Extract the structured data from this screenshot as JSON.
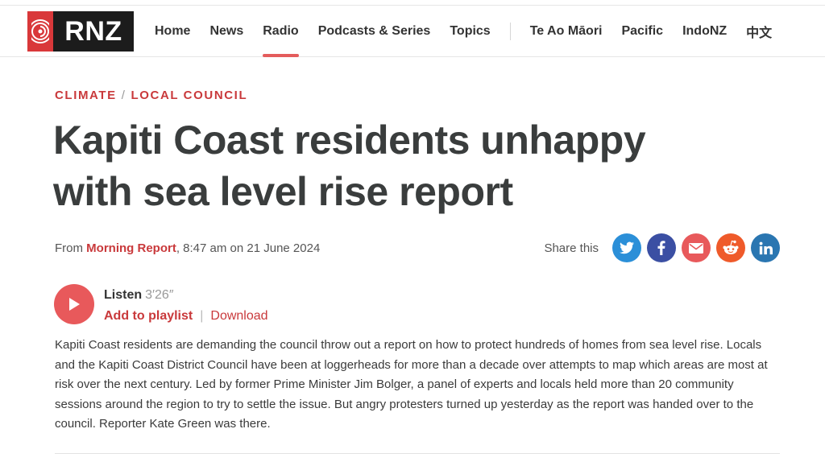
{
  "header": {
    "logo_text": "RNZ",
    "nav": [
      {
        "label": "Home",
        "active": false
      },
      {
        "label": "News",
        "active": false
      },
      {
        "label": "Radio",
        "active": true
      },
      {
        "label": "Podcasts & Series",
        "active": false
      },
      {
        "label": "Topics",
        "active": false
      },
      {
        "label": "Te Ao Māori",
        "active": false
      },
      {
        "label": "Pacific",
        "active": false
      },
      {
        "label": "IndoNZ",
        "active": false
      },
      {
        "label": "中文",
        "active": false
      }
    ]
  },
  "article": {
    "breadcrumbs": [
      "CLIMATE",
      "LOCAL COUNCIL"
    ],
    "breadcrumb_separator": "/",
    "title": "Kapiti Coast residents unhappy with sea level rise report",
    "meta": {
      "from_label": "From",
      "programme": "Morning Report",
      "datetime": ", 8:47 am on 21 June 2024"
    },
    "share": {
      "label": "Share this",
      "buttons": [
        {
          "name": "twitter",
          "icon": "twitter-icon",
          "color": "#2b8fd8"
        },
        {
          "name": "facebook",
          "icon": "facebook-icon",
          "color": "#3b4fa3"
        },
        {
          "name": "email",
          "icon": "email-icon",
          "color": "#e8595b"
        },
        {
          "name": "reddit",
          "icon": "reddit-icon",
          "color": "#ef5a2a"
        },
        {
          "name": "linkedin",
          "icon": "linkedin-icon",
          "color": "#2a76b1"
        }
      ]
    },
    "audio": {
      "listen_label": "Listen",
      "duration": "3′26″",
      "add_to_playlist": "Add to playlist",
      "separator": "|",
      "download": "Download"
    },
    "summary": "Kapiti Coast residents are demanding the council throw out a report on how to protect hundreds of homes from sea level rise. Locals and the Kapiti Coast District Council have been at loggerheads for more than a decade over attempts to map which areas are most at risk over the next century. Led by former Prime Minister Jim Bolger, a panel of experts and locals held more than 20 community sessions around the region to try to settle the issue. But angry protesters turned up yesterday as the report was handed over to the council. Reporter Kate Green was there."
  },
  "colors": {
    "accent": "#c9393b",
    "play_button": "#e8595b",
    "nav_underline": "#e45c5c"
  }
}
